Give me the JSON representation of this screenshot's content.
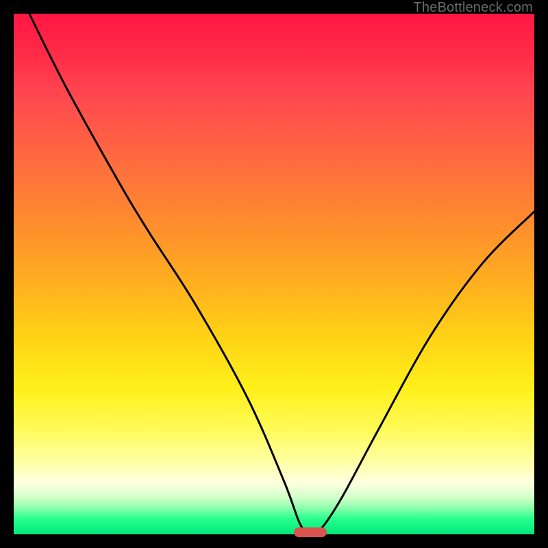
{
  "watermark": "TheBottleneck.com",
  "colors": {
    "gradient_top": "#ff1744",
    "gradient_mid": "#ffd216",
    "gradient_bottom": "#00e87a",
    "curve": "#000000",
    "marker": "#d9534f",
    "frame": "#000000"
  },
  "chart_data": {
    "type": "line",
    "title": "",
    "xlabel": "",
    "ylabel": "",
    "xlim": [
      0,
      100
    ],
    "ylim": [
      0,
      100
    ],
    "grid": false,
    "series": [
      {
        "name": "bottleneck-curve",
        "x": [
          3,
          10,
          20,
          26,
          35,
          45,
          52,
          55,
          57,
          59,
          63,
          70,
          80,
          90,
          100
        ],
        "values": [
          100,
          86,
          68,
          58,
          44,
          26,
          10,
          2,
          0,
          1,
          7,
          20,
          38,
          52,
          62
        ]
      }
    ],
    "annotations": [
      {
        "name": "optimum-marker",
        "x": 57,
        "y": 0
      }
    ]
  }
}
